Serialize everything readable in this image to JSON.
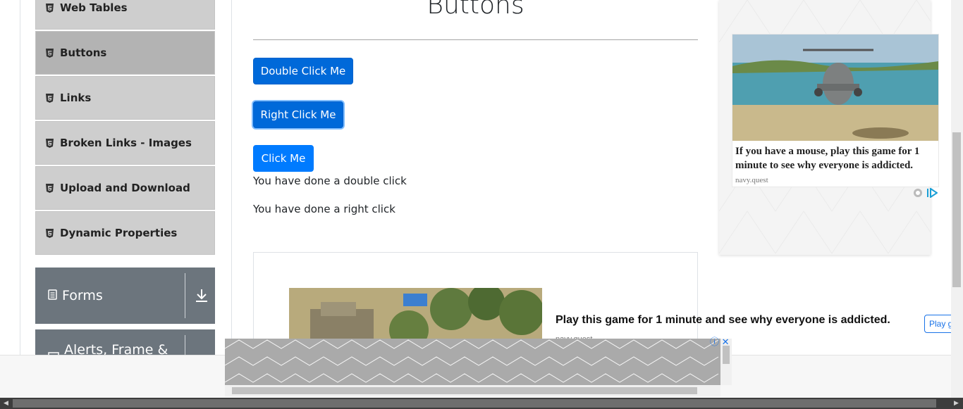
{
  "sidebar": {
    "items": [
      {
        "label": "Web Tables"
      },
      {
        "label": "Buttons"
      },
      {
        "label": "Links"
      },
      {
        "label": "Broken Links - Images"
      },
      {
        "label": "Upload and Download"
      },
      {
        "label": "Dynamic Properties"
      }
    ],
    "groups": [
      {
        "label": "Forms"
      },
      {
        "label": "Alerts, Frame & Windows"
      }
    ]
  },
  "main": {
    "title": "Buttons",
    "buttons": {
      "double_click": "Double Click Me",
      "right_click": "Right Click Me",
      "click": "Click Me"
    },
    "messages": {
      "double": "You have done a double click",
      "right": "You have done a right click"
    }
  },
  "ad_inline": {
    "headline": "Play this game for 1 minute and see why everyone is addicted.",
    "source": "navy.quest",
    "play_label": "Play game"
  },
  "ad_right": {
    "text": "If you have a mouse, play this game for 1 minute to see why everyone is addicted.",
    "source": "navy.quest"
  },
  "colors": {
    "primary_button": "#007bff",
    "sidebar_item": "#cecece",
    "group_header": "#6c757d"
  }
}
